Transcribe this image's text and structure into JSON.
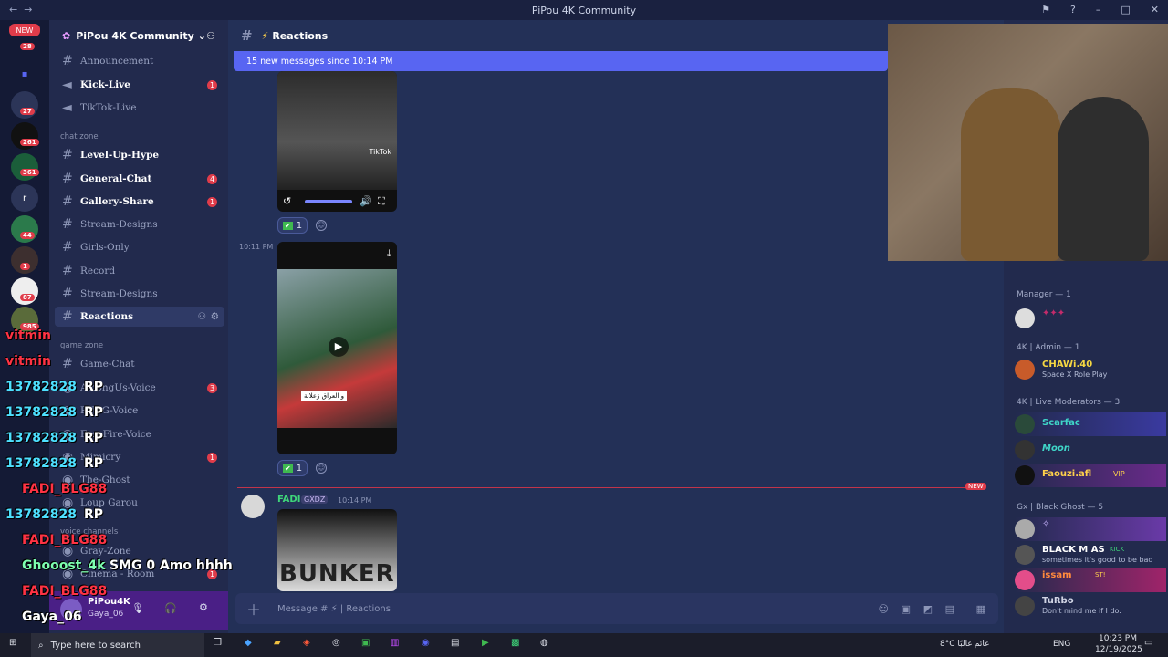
{
  "window": {
    "title": "PiPou 4K Community"
  },
  "guilds": [
    {
      "label": "NEW",
      "badge": "28"
    },
    {
      "label": "",
      "badge": ""
    },
    {
      "label": "",
      "badge": "27"
    },
    {
      "label": "",
      "badge": "261"
    },
    {
      "label": "",
      "badge": "361"
    },
    {
      "label": "r",
      "badge": ""
    },
    {
      "label": "",
      "badge": "44"
    },
    {
      "label": "",
      "badge": "1"
    },
    {
      "label": "",
      "badge": "87"
    },
    {
      "label": "",
      "badge": "985"
    }
  ],
  "server": {
    "name": "PiPou 4K Community"
  },
  "channels": [
    {
      "label": "Announcement",
      "badge": ""
    },
    {
      "label": "Kick-Live",
      "badge": "1"
    },
    {
      "label": "TikTok-Live",
      "badge": ""
    },
    {
      "label": "Level-Up-Hype",
      "badge": ""
    },
    {
      "label": "General-Chat",
      "badge": "4"
    },
    {
      "label": "Gallery-Share",
      "badge": "1"
    },
    {
      "label": "Stream-Designs",
      "badge": ""
    },
    {
      "label": "Girls-Only",
      "badge": ""
    },
    {
      "label": "Record",
      "badge": ""
    },
    {
      "label": "Stream-Designs",
      "badge": ""
    },
    {
      "label": "Reactions",
      "badge": ""
    },
    {
      "label": "Game-Chat",
      "badge": ""
    },
    {
      "label": "AmongUs-Voice",
      "badge": "3"
    },
    {
      "label": "PUBG-Voice",
      "badge": ""
    },
    {
      "label": "FreeFire-Voice",
      "badge": ""
    },
    {
      "label": "Mimicry",
      "badge": "1"
    },
    {
      "label": "The-Ghost",
      "badge": ""
    },
    {
      "label": "Loup Garou",
      "badge": ""
    },
    {
      "label": "Gray-Zone",
      "badge": ""
    },
    {
      "label": "Cinema - Room",
      "badge": "1"
    }
  ],
  "categories": {
    "chat": "chat zone",
    "game": "game zone",
    "voice": "voice channels"
  },
  "user": {
    "name": "PiPou4K",
    "status": "Gaya_06"
  },
  "channel": {
    "name": "Reactions"
  },
  "new_messages": "15 new messages since 10:14 PM",
  "messages": [
    {
      "time": "10:11 PM",
      "caption": "و العراق زعلانة",
      "reaction_count": "1"
    },
    {
      "author": "FADI",
      "tag": "GXDZ",
      "time": "10:14 PM",
      "video_text": "BUNKER"
    }
  ],
  "first_reaction_count": "1",
  "video_watermark": "TikTok",
  "new_label": "NEW",
  "composer": {
    "placeholder": "Message # ⚡ | Reactions"
  },
  "members": {
    "groups": [
      {
        "name": "Manager — 1"
      },
      {
        "name": "4K | Admin — 1"
      },
      {
        "name": "4K | Live Moderators — 3"
      },
      {
        "name": "Gx | Black Ghost — 5"
      }
    ],
    "list": [
      {
        "name": "CHAWi.40",
        "status": "Space X Role Play",
        "color": "#f5d742"
      },
      {
        "name": "Scarfac",
        "status": "",
        "color": "#3fd6c8"
      },
      {
        "name": "Moon",
        "status": "",
        "color": "#3fd6c8"
      },
      {
        "name": "Faouzi.afl",
        "status": "",
        "color": "#ffd24a"
      },
      {
        "name": "BLACK M AS",
        "status": "sometimes it's good to be bad",
        "color": "#ffffff"
      },
      {
        "name": "issam",
        "status": "",
        "color": "#ff8a3d"
      },
      {
        "name": "TuRbo",
        "status": "Don't mind me if I do.",
        "color": "#d0d4e4"
      }
    ],
    "badges": {
      "kick": "KICK",
      "vip": "VIP",
      "st": "ST!"
    }
  },
  "overlay_chat": [
    {
      "user": "vitmin",
      "msg": ""
    },
    {
      "user": "vitmin",
      "msg": ""
    },
    {
      "user": "13782828",
      "msg": "RP"
    },
    {
      "user": "13782828",
      "msg": "RP"
    },
    {
      "user": "13782828",
      "msg": "RP"
    },
    {
      "user": "13782828",
      "msg": "RP"
    },
    {
      "user": "FADI_BLG88",
      "msg": ""
    },
    {
      "user": "13782828",
      "msg": "RP"
    },
    {
      "user": "FADI_BLG88",
      "msg": ""
    },
    {
      "user": "Ghooost_4k",
      "msg": "SMG 0 Amo hhhh"
    },
    {
      "user": "FADI_BLG88",
      "msg": ""
    },
    {
      "user": "Gaya_06",
      "msg": ""
    }
  ],
  "taskbar": {
    "search": "Type here to search",
    "weather": "8°C  غائم غالبًا",
    "lang": "ENG",
    "time": "10:23 PM",
    "date": "12/19/2025"
  },
  "colors": {
    "accent": "#5865f2",
    "mention": "#e03c4a"
  }
}
